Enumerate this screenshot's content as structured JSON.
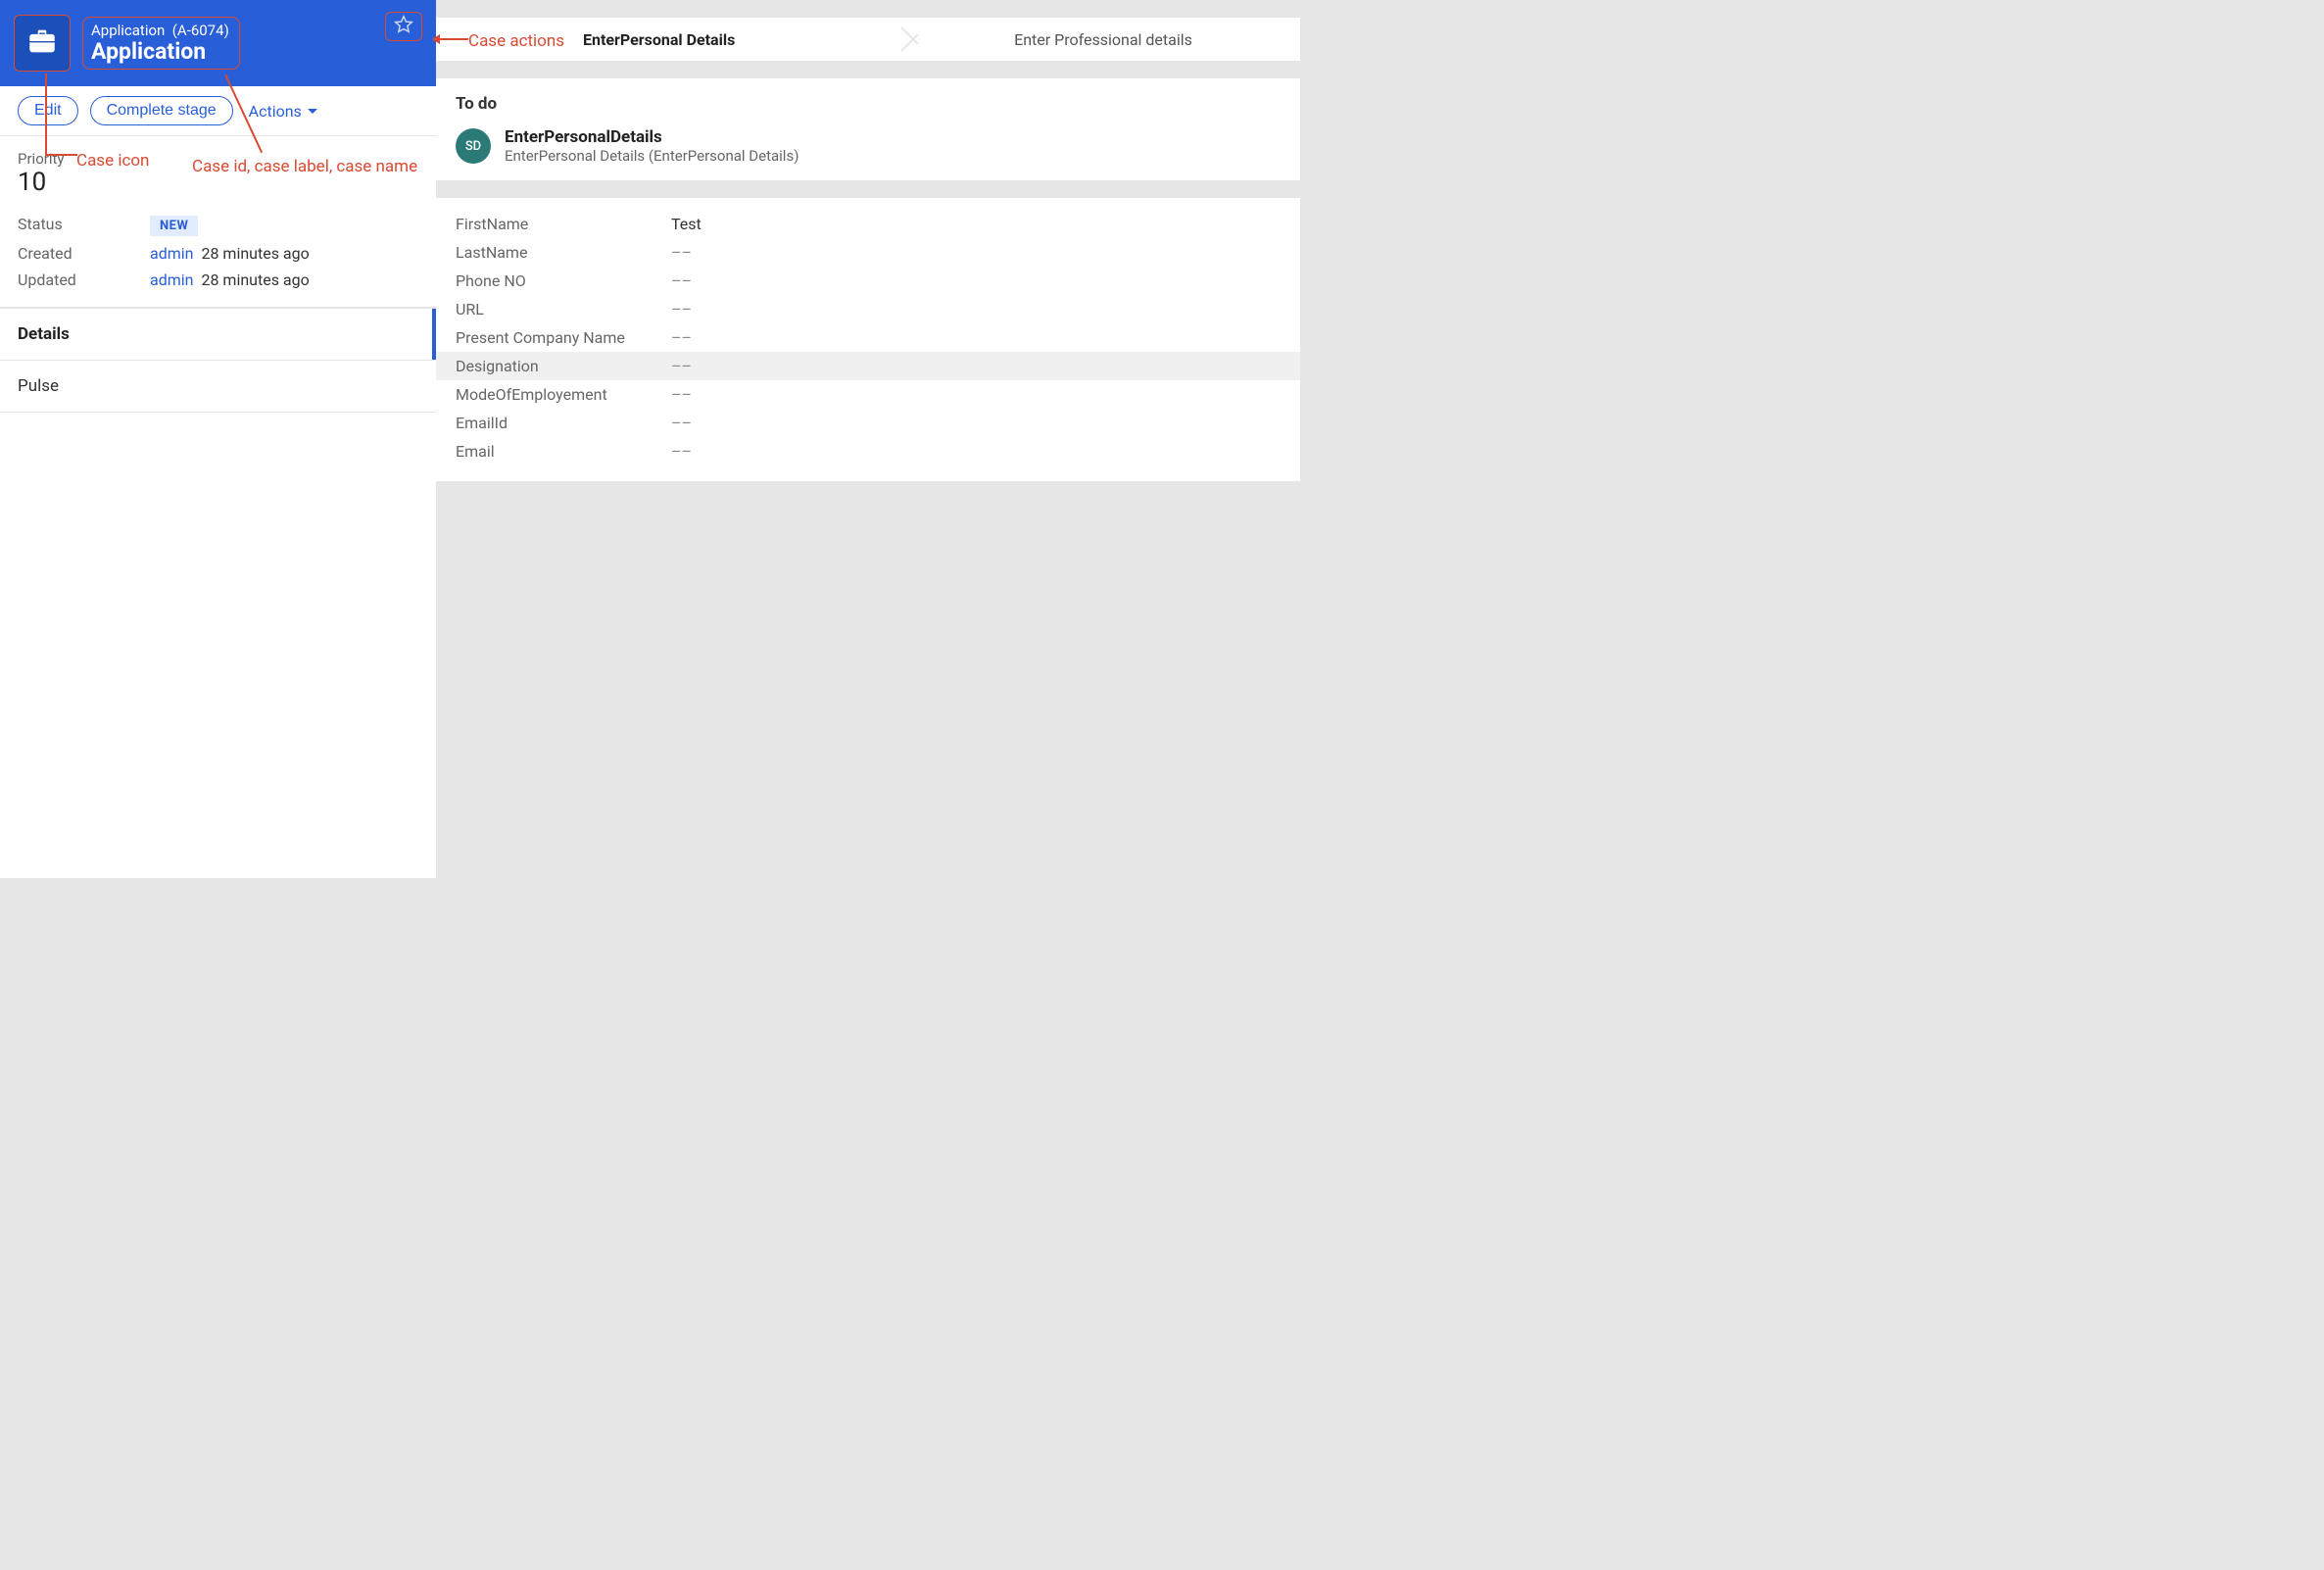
{
  "header": {
    "case_label": "Application",
    "case_id": "(A-6074)",
    "case_name": "Application"
  },
  "toolbar": {
    "edit": "Edit",
    "complete_stage": "Complete stage",
    "actions": "Actions"
  },
  "summary": {
    "priority_label": "Priority",
    "priority_value": "10",
    "status_label": "Status",
    "status_value": "NEW",
    "created_label": "Created",
    "created_user": "admin",
    "created_ago": "28 minutes ago",
    "updated_label": "Updated",
    "updated_user": "admin",
    "updated_ago": "28 minutes ago"
  },
  "tabs": {
    "details": "Details",
    "pulse": "Pulse"
  },
  "breadcrumb": {
    "step1": "EnterPersonal Details",
    "step2": "Enter Professional details"
  },
  "todo": {
    "title": "To do",
    "avatar": "SD",
    "main": "EnterPersonalDetails",
    "sub": "EnterPersonal Details (EnterPersonal Details)"
  },
  "form": [
    {
      "k": "FirstName",
      "v": "Test",
      "empty": false
    },
    {
      "k": "LastName",
      "v": "––",
      "empty": true
    },
    {
      "k": "Phone NO",
      "v": "––",
      "empty": true
    },
    {
      "k": "URL",
      "v": "––",
      "empty": true
    },
    {
      "k": "Present Company Name",
      "v": "––",
      "empty": true
    },
    {
      "k": "Designation",
      "v": "––",
      "empty": true,
      "hover": true
    },
    {
      "k": "ModeOfEmployement",
      "v": "––",
      "empty": true
    },
    {
      "k": "EmailId",
      "v": "––",
      "empty": true
    },
    {
      "k": "Email",
      "v": "––",
      "empty": true
    }
  ],
  "annotations": {
    "case_icon": "Case icon",
    "case_ids": "Case id, case label, case name",
    "case_actions": "Case actions"
  }
}
